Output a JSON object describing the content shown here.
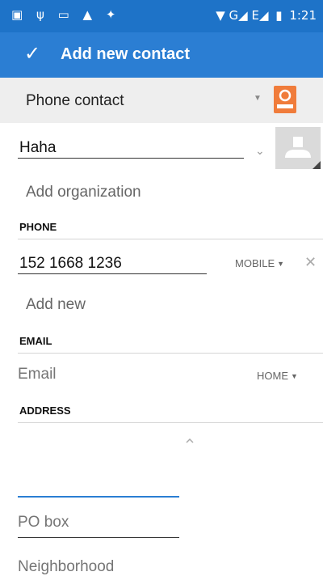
{
  "status_bar": {
    "left_icons": [
      "image-icon",
      "usb-icon",
      "battery-saver-icon",
      "warning-icon",
      "android-debug-icon"
    ],
    "left_glyphs": "▣ ψ ▭ ▲ ✦",
    "signal_glyphs": "▼ G◢ E◢",
    "time": "1:21"
  },
  "action_bar": {
    "title": "Add new contact",
    "check": "✓"
  },
  "account": {
    "label": "Phone contact"
  },
  "name": {
    "value": "Haha"
  },
  "organization": {
    "placeholder": "Add organization"
  },
  "phone": {
    "header": "PHONE",
    "value": "152 1668 1236",
    "type": "MOBILE",
    "add_new": "Add new"
  },
  "email": {
    "header": "EMAIL",
    "placeholder": "Email",
    "type": "HOME"
  },
  "address": {
    "header": "ADDRESS",
    "po_box_placeholder": "PO box",
    "neighborhood_placeholder": "Neighborhood"
  },
  "colors": {
    "status_bar": "#1E73C8",
    "action_bar": "#2B7ED3",
    "account_icon": "#F07C3B"
  }
}
